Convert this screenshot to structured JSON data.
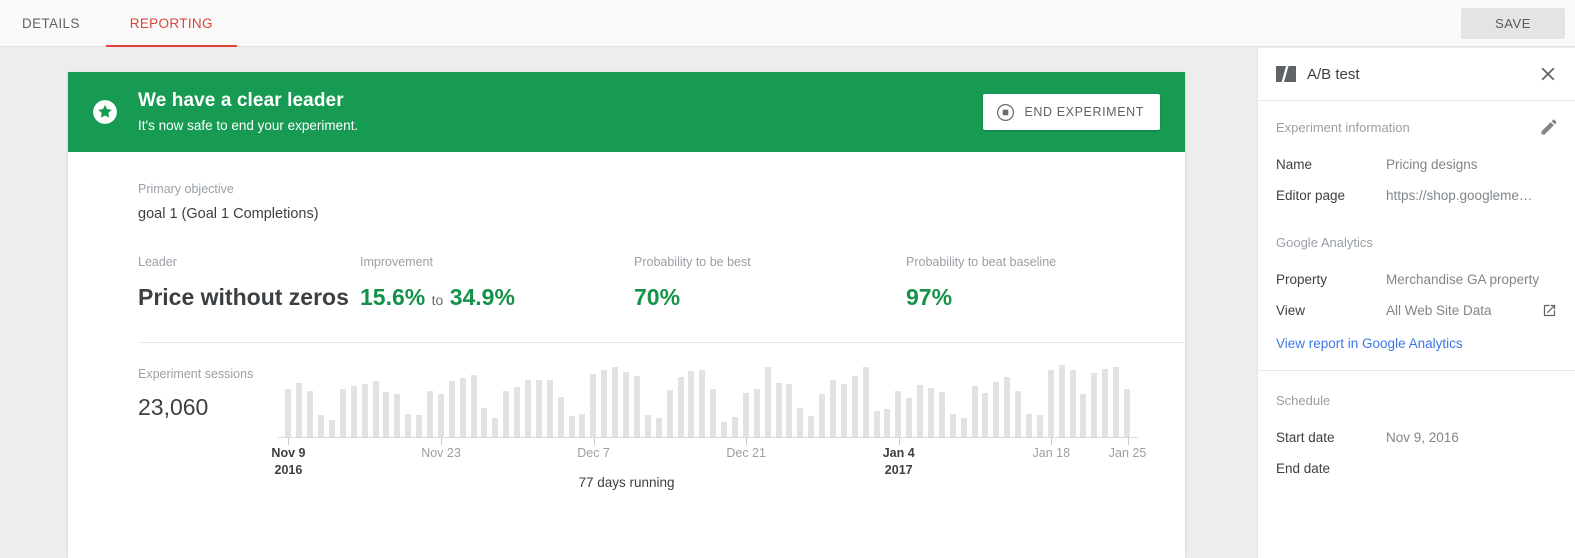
{
  "topbar": {
    "tabs": [
      {
        "label": "DETAILS",
        "active": false
      },
      {
        "label": "REPORTING",
        "active": true
      }
    ],
    "save_label": "SAVE"
  },
  "banner": {
    "icon": "star-circle-icon",
    "title": "We have a clear leader",
    "subtitle": "It's now safe to end your experiment.",
    "button_label": "END EXPERIMENT",
    "button_icon": "stop-circle-icon",
    "color": "#179b53"
  },
  "summary": {
    "primary_objective_label": "Primary objective",
    "primary_objective_value": "goal 1 (Goal 1 Completions)",
    "metrics": [
      {
        "label": "Leader",
        "value": "Price without zeros",
        "style": "dark"
      },
      {
        "label": "Improvement",
        "value_low": "15.6%",
        "joiner": "to",
        "value_high": "34.9%",
        "style": "range-green"
      },
      {
        "label": "Probability to be best",
        "value": "70%",
        "style": "green"
      },
      {
        "label": "Probability to beat baseline",
        "value": "97%",
        "style": "green"
      }
    ],
    "accent_green": "#14924a"
  },
  "sessions": {
    "label": "Experiment sessions",
    "value": "23,060",
    "days_running": "77 days running"
  },
  "chart_data": {
    "type": "bar",
    "title": "Experiment sessions",
    "xlabel": "",
    "ylabel": "",
    "grid": false,
    "legend": null,
    "bar_color": "#e2e2e2",
    "x": [
      "Nov 9",
      "Nov 10",
      "Nov 11",
      "Nov 12",
      "Nov 13",
      "Nov 14",
      "Nov 15",
      "Nov 16",
      "Nov 17",
      "Nov 18",
      "Nov 19",
      "Nov 20",
      "Nov 21",
      "Nov 22",
      "Nov 23",
      "Nov 24",
      "Nov 25",
      "Nov 26",
      "Nov 27",
      "Nov 28",
      "Nov 29",
      "Nov 30",
      "Dec 1",
      "Dec 2",
      "Dec 3",
      "Dec 4",
      "Dec 5",
      "Dec 6",
      "Dec 7",
      "Dec 8",
      "Dec 9",
      "Dec 10",
      "Dec 11",
      "Dec 12",
      "Dec 13",
      "Dec 14",
      "Dec 15",
      "Dec 16",
      "Dec 17",
      "Dec 18",
      "Dec 19",
      "Dec 20",
      "Dec 21",
      "Dec 22",
      "Dec 23",
      "Dec 24",
      "Dec 25",
      "Dec 26",
      "Dec 27",
      "Dec 28",
      "Dec 29",
      "Dec 30",
      "Dec 31",
      "Jan 1",
      "Jan 2",
      "Jan 3",
      "Jan 4",
      "Jan 5",
      "Jan 6",
      "Jan 7",
      "Jan 8",
      "Jan 9",
      "Jan 10",
      "Jan 11",
      "Jan 12",
      "Jan 13",
      "Jan 14",
      "Jan 15",
      "Jan 16",
      "Jan 17",
      "Jan 18",
      "Jan 19",
      "Jan 20",
      "Jan 21",
      "Jan 22",
      "Jan 23",
      "Jan 24",
      "Jan 25"
    ],
    "values": [
      62,
      70,
      59,
      29,
      22,
      62,
      66,
      68,
      72,
      58,
      55,
      30,
      28,
      60,
      55,
      72,
      76,
      80,
      38,
      24,
      60,
      64,
      74,
      73,
      73,
      52,
      27,
      30,
      82,
      87,
      91,
      84,
      79,
      28,
      24,
      61,
      77,
      85,
      86,
      62,
      19,
      26,
      57,
      62,
      91,
      70,
      68,
      37,
      27,
      55,
      73,
      69,
      79,
      90,
      33,
      36,
      59,
      50,
      67,
      63,
      58,
      30,
      25,
      66,
      57,
      71,
      78,
      60,
      30,
      28,
      86,
      93,
      87,
      55,
      83,
      88,
      90,
      62
    ],
    "tick_labels": [
      {
        "text": "Nov 9",
        "year": "2016",
        "index": 0,
        "major": true
      },
      {
        "text": "Nov 23",
        "year": "",
        "index": 14,
        "major": false
      },
      {
        "text": "Dec 7",
        "year": "",
        "index": 28,
        "major": false
      },
      {
        "text": "Dec 21",
        "year": "",
        "index": 42,
        "major": false
      },
      {
        "text": "Jan 4",
        "year": "2017",
        "index": 56,
        "major": true
      },
      {
        "text": "Jan 18",
        "year": "",
        "index": 70,
        "major": false
      },
      {
        "text": "Jan 25",
        "year": "",
        "index": 77,
        "major": false
      }
    ]
  },
  "sidebar": {
    "title": "A/B test",
    "icon": "ab-test-icon",
    "close_icon": "close-icon",
    "edit_icon": "pencil-icon",
    "sections": [
      {
        "title": "Experiment information",
        "rows": [
          {
            "key": "Name",
            "value": "Pricing designs",
            "external": false
          },
          {
            "key": "Editor page",
            "value": "https://shop.googleme…",
            "external": false
          }
        ]
      },
      {
        "title": "Google Analytics",
        "rows": [
          {
            "key": "Property",
            "value": "Merchandise GA property",
            "external": false
          },
          {
            "key": "View",
            "value": "All Web Site Data",
            "external": true
          }
        ],
        "link": "View report in Google Analytics"
      },
      {
        "title": "Schedule",
        "rows": [
          {
            "key": "Start date",
            "value": "Nov 9, 2016",
            "external": false
          },
          {
            "key": "End date",
            "value": "",
            "external": false
          }
        ]
      }
    ],
    "link_color": "#3b78e7"
  }
}
